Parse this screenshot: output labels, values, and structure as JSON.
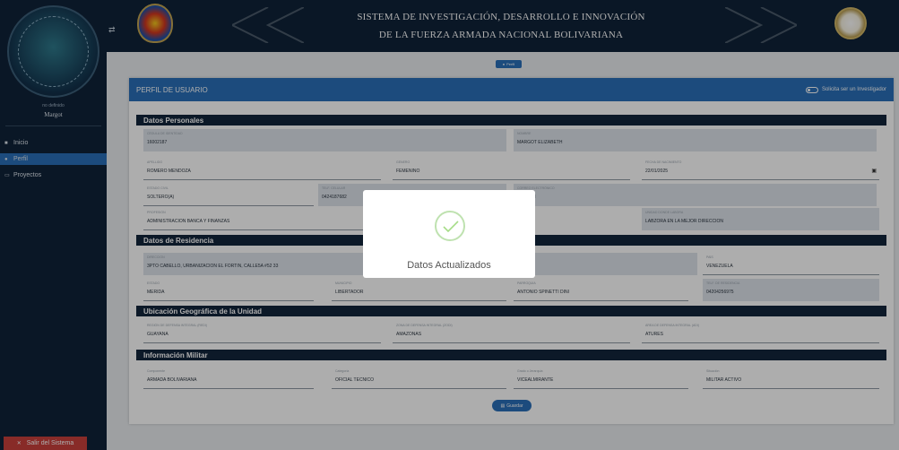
{
  "sidebar": {
    "role": "no definido",
    "username": "Margot",
    "items": [
      {
        "icon": "home-icon",
        "label": "Inicio"
      },
      {
        "icon": "user-icon",
        "label": "Perfil"
      },
      {
        "icon": "folder-icon",
        "label": "Proyectos"
      }
    ],
    "logout_label": "Salir del Sistema"
  },
  "header": {
    "title_line1": "SISTEMA DE INVESTIGACIÓN, DESARROLLO E INNOVACIÓN",
    "title_line2": "DE LA FUERZA ARMADA NACIONAL BOLIVARIANA"
  },
  "profile_pill": "Perfil",
  "card": {
    "title": "PERFIL DE USUARIO",
    "toggle_label": "Solicita ser un Investigador"
  },
  "sections": {
    "personal": "Datos Personales",
    "residence": "Datos de Residencia",
    "location": "Ubicación Geográfica de la Unidad",
    "military": "Información Militar"
  },
  "fields": {
    "cedula": {
      "label": "CÉDULA DE IDENTIDAD",
      "value": "16002187"
    },
    "nombre": {
      "label": "NOMBRE",
      "value": "MARGOT ELIZABETH"
    },
    "apellido": {
      "label": "APELLIDO",
      "value": "ROMERO MENDOZA"
    },
    "genero": {
      "label": "GENERO",
      "value": "FEMENINO"
    },
    "fecha": {
      "label": "FECHA DE NACIMIENTO",
      "value": "22/01/2025"
    },
    "estado_civil": {
      "label": "ESTADO CIVIL",
      "value": "SOLTERO(A)"
    },
    "telefono": {
      "label": "TELF. CELULAR",
      "value": "0424187682"
    },
    "correo": {
      "label": "CORREO ELECTRÓNICO",
      "value": "AIL.COM"
    },
    "profesion": {
      "label": "PROFESIÓN",
      "value": "ADMINISTRACIÓN BANCA Y FINANZAS"
    },
    "unidad": {
      "label": "UNIDAD DONDE LABORA",
      "value": "LABZORA EN LA MEJOR DIRECCIÓN"
    },
    "direccion": {
      "label": "DIRECCIÓN",
      "value": "3PTO CABELLO, URBANIZACIÓN EL FORTIN, CALLE5A #52 33"
    },
    "pais": {
      "label": "PAÍS",
      "value": "VENEZUELA"
    },
    "estado": {
      "label": "ESTADO",
      "value": "MÉRIDA"
    },
    "municipio": {
      "label": "MUNICIPIO",
      "value": "LIBERTADOR"
    },
    "parroquia": {
      "label": "PARROQUIA",
      "value": "ANTONIO SPINETTI DINI"
    },
    "telf_res": {
      "label": "TELF. DE RESIDENCIA",
      "value": "04204256975"
    },
    "region": {
      "label": "REGIÓN DE DEFENSA INTEGRAL (REDI)",
      "value": "GUAYANA"
    },
    "zona": {
      "label": "ZONA DE DEFENSA INTEGRAL (ZODI)",
      "value": "AMAZONAS"
    },
    "area": {
      "label": "ÁREA DE DEFENSA INTEGRAL (ADI)",
      "value": "ATURES"
    },
    "componente": {
      "label": "Componente",
      "value": "ARMADA BOLIVARIANA"
    },
    "categoria": {
      "label": "Categoría",
      "value": "OFICIAL TÉCNICO"
    },
    "grado": {
      "label": "Grado o Jerarquía",
      "value": "VICEALMIRANTE"
    },
    "situacion": {
      "label": "Situación",
      "value": "MILITAR ACTIVO"
    }
  },
  "save_label": "Guardar",
  "modal": {
    "message": "Datos Actualizados"
  }
}
